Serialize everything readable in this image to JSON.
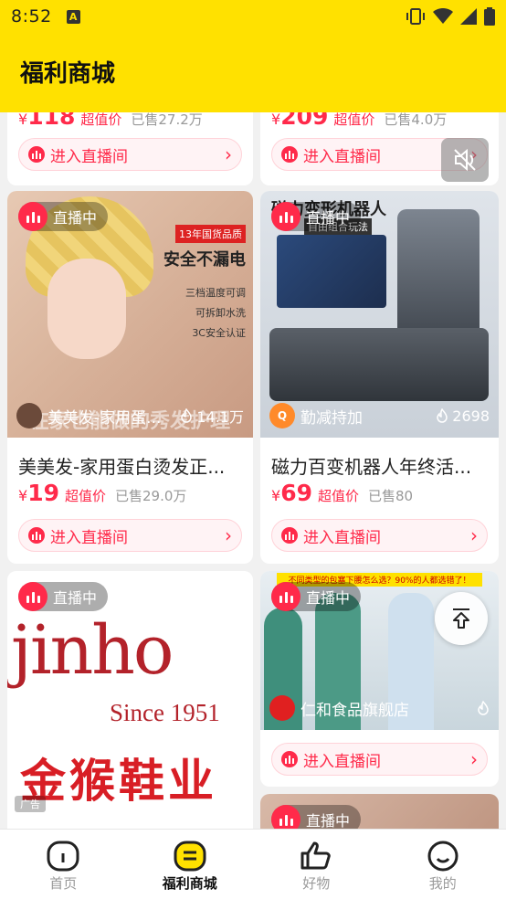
{
  "status_bar": {
    "time": "8:52",
    "notif": "A"
  },
  "header": {
    "title": "福利商城"
  },
  "top_cards": [
    {
      "price_prefix": "¥",
      "price": "118",
      "price_tag": "超值价",
      "sold": "已售27.2万",
      "enter_label": "进入直播间"
    },
    {
      "price_prefix": "¥",
      "price": "209",
      "price_tag": "超值价",
      "sold": "已售4.0万",
      "enter_label": "进入直播间"
    }
  ],
  "cards": [
    {
      "live_label": "直播中",
      "banner_line1": "13年国货品质",
      "banner_line2": "安全不漏电",
      "banner_points": [
        "三档温度可调",
        "可拆卸水洗",
        "3C安全认证"
      ],
      "caption": "在家也能做的秀发护理",
      "shop_name": "美美发-家用蛋...",
      "views": "14.1万",
      "title": "美美发-家用蛋白烫发正...",
      "price_prefix": "¥",
      "price": "19",
      "price_tag": "超值价",
      "sold": "已售29.0万",
      "enter_label": "进入直播间"
    },
    {
      "live_label": "直播中",
      "poster_title": "磁力变形机器人",
      "poster_sub": "自由组合玩法",
      "shop_name": "勤减持加",
      "views": "2698",
      "title": "磁力百变机器人年终活...",
      "price_prefix": "¥",
      "price": "69",
      "price_tag": "超值价",
      "sold": "已售80",
      "enter_label": "进入直播间"
    },
    {
      "live_label": "直播中",
      "brand": "jinho",
      "since": "Since 1951",
      "brand_cn": "金猴鞋业",
      "ad_label": "广告"
    },
    {
      "live_label": "直播中",
      "banner": "不同类型的包塞下腰怎么选？90%的人都选错了！",
      "shop_name": "仁和食品旗舰店",
      "enter_label": "进入直播间"
    },
    {
      "live_label": "直播中"
    }
  ],
  "tabs": [
    {
      "label": "首页",
      "icon": "home-icon"
    },
    {
      "label": "福利商城",
      "icon": "mall-icon"
    },
    {
      "label": "好物",
      "icon": "thumb-up-icon"
    },
    {
      "label": "我的",
      "icon": "profile-icon"
    }
  ],
  "colors": {
    "header": "#ffe100",
    "accent": "#ff2a4a"
  }
}
